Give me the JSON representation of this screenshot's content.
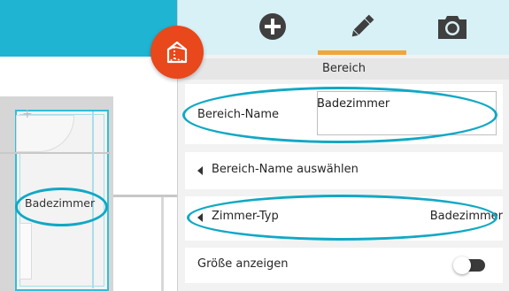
{
  "app": {
    "section_title": "Bereich"
  },
  "toolbar": {
    "add_icon": "plus-circle-icon",
    "edit_icon": "pencil-icon",
    "camera_icon": "camera-icon",
    "active_tool": "edit",
    "fab_icon": "room-box-icon"
  },
  "canvas": {
    "room_label": "Badezimmer"
  },
  "form": {
    "name_label": "Bereich-Name",
    "name_value": "Badezimmer",
    "select_name_label": "Bereich-Name auswählen",
    "room_type_label": "Zimmer-Typ",
    "room_type_value": "Badezimmer",
    "show_size_label": "Größe anzeigen",
    "show_size_enabled": false
  },
  "colors": {
    "accent_cyan": "#1fb4d1",
    "fab_orange": "#e8481b",
    "tab_indicator": "#f3a43a",
    "highlight_ellipse": "#11a8c5"
  }
}
